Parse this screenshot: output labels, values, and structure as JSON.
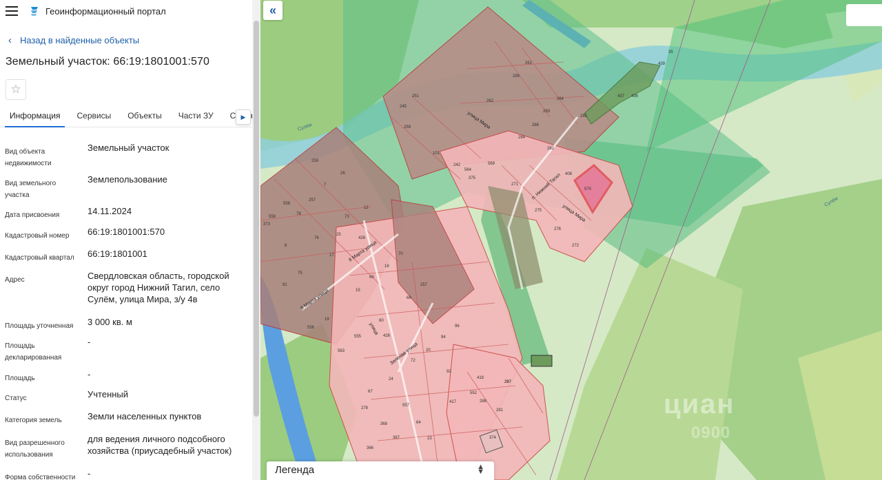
{
  "header": {
    "title": "Геоинформационный портал",
    "menu_icon": "hamburger-icon",
    "logo_icon": "portal-logo-icon"
  },
  "back_link": {
    "label": "Назад в найденные объекты",
    "icon": "chevron-left-icon"
  },
  "object": {
    "title": "Земельный участок: 66:19:1801001:570"
  },
  "favorite": {
    "icon": "star-icon",
    "glyph": "☆"
  },
  "tabs": [
    {
      "label": "Информация",
      "active": true
    },
    {
      "label": "Сервисы"
    },
    {
      "label": "Объекты"
    },
    {
      "label": "Части ЗУ"
    },
    {
      "label": "Соста"
    }
  ],
  "properties": [
    {
      "label": "Вид объекта недвижимости",
      "value": "Земельный участок"
    },
    {
      "label": "Вид земельного участка",
      "value": "Землепользование"
    },
    {
      "label": "Дата присвоения",
      "value": "14.11.2024"
    },
    {
      "label": "Кадастровый номер",
      "value": "66:19:1801001:570"
    },
    {
      "label": "Кадастровый квартал",
      "value": "66:19:1801001"
    },
    {
      "label": "Адрес",
      "value": "Свердловская область, городской округ город Нижний Тагил, село Сулём, улица Мира, з/у 4в"
    },
    {
      "label": "Площадь уточненная",
      "value": "3 000 кв. м"
    },
    {
      "label": "Площадь декларированная",
      "value": "-"
    },
    {
      "label": "Площадь",
      "value": "-"
    },
    {
      "label": "Статус",
      "value": "Учтенный"
    },
    {
      "label": "Категория земель",
      "value": "Земли населенных пунктов"
    },
    {
      "label": "Вид разрешенного использования",
      "value": "для ведения личного подсобного хозяйства (приусадебный участок)"
    },
    {
      "label": "Форма собственности",
      "value": "-"
    }
  ],
  "map": {
    "collapse_glyph": "«",
    "legend": {
      "label": "Легенда",
      "icon": "sort-arrows-icon"
    },
    "watermark": "циан",
    "watermark_digits": "0900",
    "streets": [
      "улица Мира",
      "улица Мира",
      "8 Марта улица",
      "8 Марта улица",
      "улица",
      "Зелёная улица",
      "п. Нижний Тагил",
      "Сулём",
      "Сулём"
    ],
    "parcel_labels": [
      "261",
      "295",
      "262",
      "263",
      "264",
      "285",
      "286",
      "284",
      "282",
      "251",
      "245",
      "259",
      "101",
      "242",
      "564",
      "375",
      "569",
      "271",
      "408",
      "570",
      "275",
      "276",
      "272",
      "287",
      "259",
      "26",
      "7",
      "558",
      "257",
      "78",
      "12",
      "73",
      "558",
      "373",
      "8",
      "76",
      "25",
      "426",
      "17",
      "75",
      "91",
      "70",
      "69",
      "18",
      "257",
      "68",
      "15",
      "556",
      "19",
      "555",
      "563",
      "60",
      "426",
      "94",
      "96",
      "20",
      "72",
      "92",
      "67",
      "24",
      "278",
      "557",
      "64",
      "368",
      "367",
      "23",
      "366",
      "418",
      "287",
      "552",
      "288",
      "281",
      "417",
      "374",
      "35",
      "439",
      "437",
      "436"
    ],
    "colors": {
      "forest": "#8fc47a",
      "water": "#7ab8e8",
      "parcel": "#f4b7b9",
      "zone": "#5cbf8c",
      "selected": "#e0202a"
    }
  }
}
